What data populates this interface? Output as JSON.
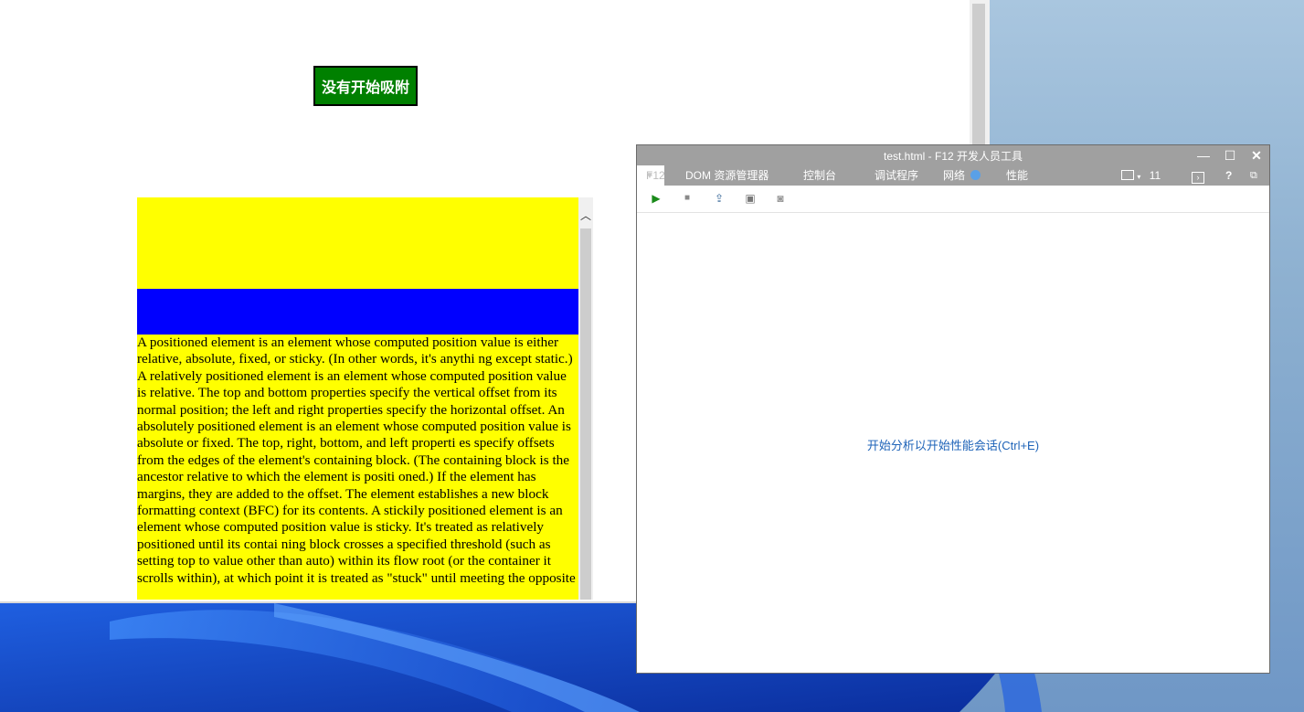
{
  "page": {
    "adhere_button_label": "没有开始吸附",
    "paragraph": "A positioned element is an element whose computed position value is either relative, absolute, fixed, or sticky. (In other words, it's anythi ng except static.) A relatively positioned element is an element whose computed position value is relative. The top and bottom properties specify the vertical offset from its normal position; the left and right properties specify the horizontal offset. An absolutely positioned element is an element whose computed position value is absolute or fixed. The top, right, bottom, and left properti es specify offsets from the edges of the element's containing block. (The containing block is the ancestor relative to which the element is positi oned.) If the element has margins, they are added to the offset. The element establishes a new block formatting context (BFC) for its contents. A stickily positioned element is an element whose computed position value is sticky. It's treated as relatively positioned until its contai ning block crosses a specified threshold (such as setting top to value other than auto) within its flow root (or the container it scrolls within), at which point it is treated as \"stuck\" until meeting the opposite"
  },
  "devtools": {
    "title": "test.html - F12 开发人员工具",
    "tabs": {
      "f12": "F12",
      "dom": "DOM 资源管理器",
      "console": "控制台",
      "debugger": "调试程序",
      "network": "网络",
      "performance": "性能"
    },
    "emulation_version": "11",
    "hint": "开始分析以开始性能会话(Ctrl+E)"
  },
  "colors": {
    "button_bg": "#008000",
    "yellow": "#ffff00",
    "blue": "#0000ff",
    "devtools_chrome": "#a0a0a0",
    "hint_link": "#1e63b8"
  }
}
